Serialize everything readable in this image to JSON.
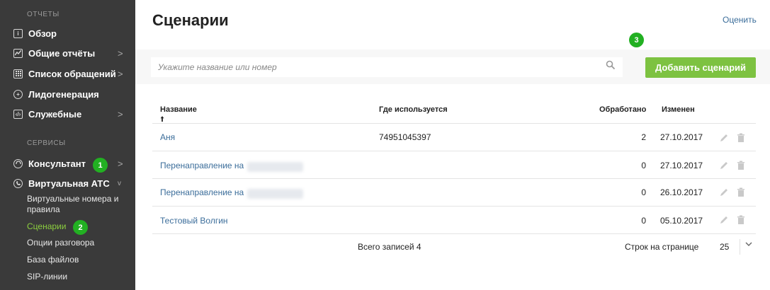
{
  "sidebar": {
    "reports_title": "ОТЧЕТЫ",
    "services_title": "СЕРВИСЫ",
    "reports": [
      {
        "label": "Обзор",
        "chevron": ""
      },
      {
        "label": "Общие отчёты",
        "chevron": ">"
      },
      {
        "label": "Список обращений",
        "chevron": ">"
      },
      {
        "label": "Лидогенерация",
        "chevron": ""
      },
      {
        "label": "Служебные",
        "chevron": ">"
      }
    ],
    "services": [
      {
        "label": "Консультант",
        "chevron": ">"
      },
      {
        "label": "Виртуальная АТС",
        "chevron": "v"
      }
    ],
    "sub_items": [
      {
        "label": "Виртуальные номера и правила"
      },
      {
        "label": "Сценарии"
      },
      {
        "label": "Опции разговора"
      },
      {
        "label": "База файлов"
      },
      {
        "label": "SIP-линии"
      }
    ],
    "badges": [
      "1",
      "2"
    ]
  },
  "header": {
    "title": "Сценарии",
    "rate_link": "Оценить",
    "badge": "3"
  },
  "toolbar": {
    "search_placeholder": "Укажите название или номер",
    "add_button": "Добавить сценарий"
  },
  "table": {
    "columns": {
      "name": "Название",
      "used_in": "Где используется",
      "processed": "Обработано",
      "changed": "Изменен"
    },
    "sort_arrow": "🠩",
    "rows": [
      {
        "name": "Аня",
        "used_in": "74951045397",
        "processed": "2",
        "changed": "27.10.2017"
      },
      {
        "name": "Перенаправление на",
        "used_in": "",
        "processed": "0",
        "changed": "27.10.2017"
      },
      {
        "name": "Перенаправление на",
        "used_in": "",
        "processed": "0",
        "changed": "26.10.2017"
      },
      {
        "name": "Тестовый Волгин",
        "used_in": "",
        "processed": "0",
        "changed": "05.10.2017"
      }
    ],
    "total": "Всего записей 4",
    "rows_per_page_label": "Строк на странице",
    "rows_per_page": "25"
  },
  "colors": {
    "sidebar_bg": "#3a3a3a",
    "accent_green": "#7dc241",
    "badge_green": "#22b022",
    "link_blue": "#3b6d9a",
    "active_item": "#8ccf3f"
  }
}
